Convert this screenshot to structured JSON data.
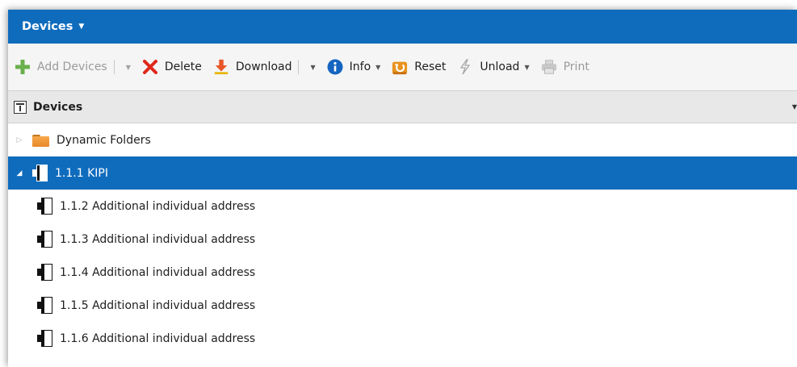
{
  "header": {
    "title": "Devices",
    "caret": "▼"
  },
  "toolbar": {
    "add_devices_label": "Add Devices",
    "delete_label": "Delete",
    "download_label": "Download",
    "info_label": "Info",
    "reset_label": "Reset",
    "unload_label": "Unload",
    "print_label": "Print",
    "dropdown_glyph": "▼"
  },
  "panel": {
    "title": "Devices",
    "dropdown_glyph": "▼"
  },
  "tree": {
    "folder": {
      "label": "Dynamic Folders",
      "expander": "▷"
    },
    "device": {
      "label": "1.1.1 KIPI",
      "expander": "◢"
    },
    "children": [
      {
        "label": "1.1.2 Additional individual address"
      },
      {
        "label": "1.1.3 Additional individual address"
      },
      {
        "label": "1.1.4 Additional individual address"
      },
      {
        "label": "1.1.5 Additional individual address"
      },
      {
        "label": "1.1.6 Additional individual address"
      }
    ]
  },
  "colors": {
    "accent": "#0f6cbd",
    "add_icon": "#6ab04c",
    "delete_icon": "#e0281b",
    "download_icon": "#e8562a",
    "info_icon": "#1565c0",
    "reset_icon": "#e89320"
  },
  "icons": {
    "add": "plus-icon",
    "delete": "x-icon",
    "download": "download-arrow-icon",
    "info": "info-circle-icon",
    "reset": "reset-arrow-icon",
    "unload": "lightning-icon",
    "print": "printer-icon",
    "panel": "device-panel-icon",
    "folder": "folder-icon",
    "device": "device-icon"
  }
}
